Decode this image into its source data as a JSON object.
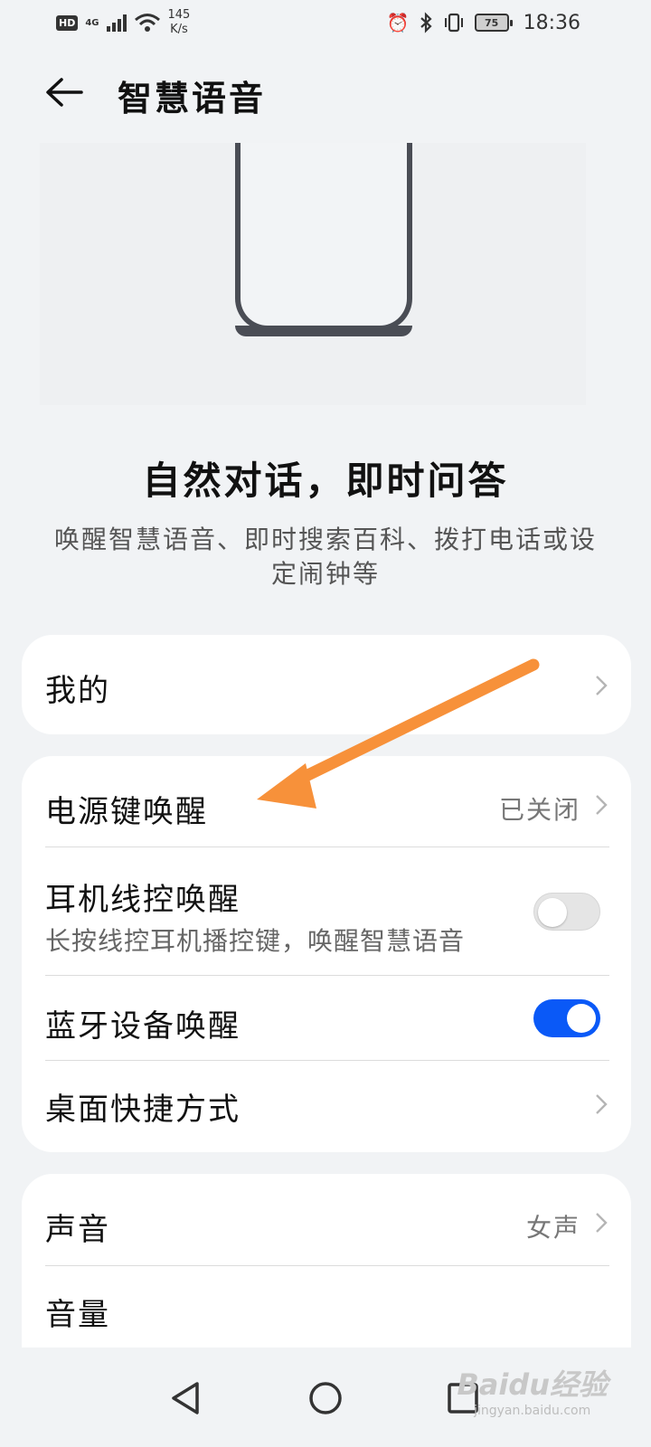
{
  "status_bar": {
    "hd_label": "HD",
    "network_type": "4G",
    "speed_value": "145",
    "speed_unit": "K/s",
    "battery_level": "75",
    "time": "18:36"
  },
  "app_bar": {
    "title": "智慧语音",
    "back_icon": "arrow-left-icon"
  },
  "hero": {
    "headline": "自然对话，即时问答",
    "description": "唤醒智慧语音、即时搜索百科、拨打电话或设定闹钟等"
  },
  "card_my": {
    "title": "我的"
  },
  "card_wakeup": {
    "power_key": {
      "title": "电源键唤醒",
      "value": "已关闭"
    },
    "headset": {
      "title": "耳机线控唤醒",
      "description": "长按线控耳机播控键，唤醒智慧语音",
      "enabled": false
    },
    "bluetooth": {
      "title": "蓝牙设备唤醒",
      "enabled": true
    },
    "shortcut": {
      "title": "桌面快捷方式"
    }
  },
  "card_voice": {
    "sound": {
      "title": "声音",
      "value": "女声"
    },
    "volume": {
      "title": "音量"
    }
  },
  "colors": {
    "toggle_on": "#0a59f7",
    "annotation_arrow": "#f7913a",
    "background": "#f1f3f5"
  },
  "watermark": {
    "logo": "Baidu经验",
    "url": "jingyan.baidu.com"
  }
}
